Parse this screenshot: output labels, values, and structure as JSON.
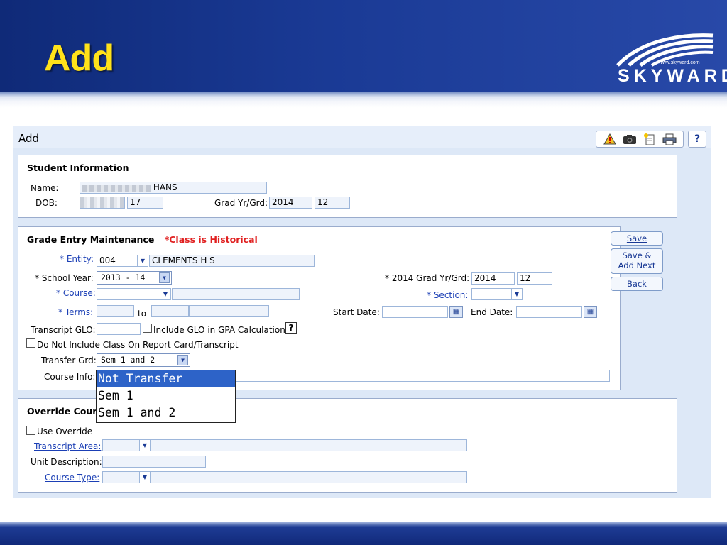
{
  "slide": {
    "title": "Add",
    "logo_url": "www.skyward.com",
    "logo_word": "SKYWARD"
  },
  "window": {
    "title": "Add",
    "help_label": "?"
  },
  "toolbar": {
    "icons": [
      "alert-icon",
      "camera-icon",
      "new-note-icon",
      "print-icon"
    ]
  },
  "student": {
    "title": "Student Information",
    "name_label": "Name:",
    "name_value": "HANS",
    "dob_label": "DOB:",
    "dob_age": "17",
    "grad_label": "Grad Yr/Grd:",
    "grad_year": "2014",
    "grad_grade": "12"
  },
  "grade_entry": {
    "title": "Grade Entry Maintenance",
    "historical_note": "*Class is Historical",
    "entity_label": "* Entity:",
    "entity_code": "004",
    "entity_name": "CLEMENTS H S",
    "school_year_label": "* School Year:",
    "school_year_value": "2013 - 14",
    "grad_label": "* 2014 Grad Yr/Grd:",
    "grad_year": "2014",
    "grad_grade": "12",
    "course_label": "* Course:",
    "section_label": "* Section:",
    "terms_label": "* Terms:",
    "terms_to": "to",
    "start_date_label": "Start Date:",
    "end_date_label": "End Date:",
    "transcript_glo_label": "Transcript GLO:",
    "include_glo_label": "Include GLO in GPA Calculation",
    "glo_help": "?",
    "do_not_include_label": "Do Not Include Class On Report Card/Transcript",
    "transfer_grd_label": "Transfer Grd:",
    "transfer_grd_value": "Sem 1 and 2",
    "course_info_label": "Course Info:"
  },
  "transfer_options": [
    "Not Transfer",
    "Sem 1",
    "Sem 1 and 2"
  ],
  "buttons": {
    "save": "Save",
    "save_add_next_1": "Save &",
    "save_add_next_2": "Add Next",
    "back": "Back"
  },
  "override": {
    "title": "Override Cours",
    "use_override_label": "Use Override",
    "transcript_area_label": "Transcript Area:",
    "unit_description_label": "Unit Description:",
    "course_type_label": "Course Type:"
  }
}
